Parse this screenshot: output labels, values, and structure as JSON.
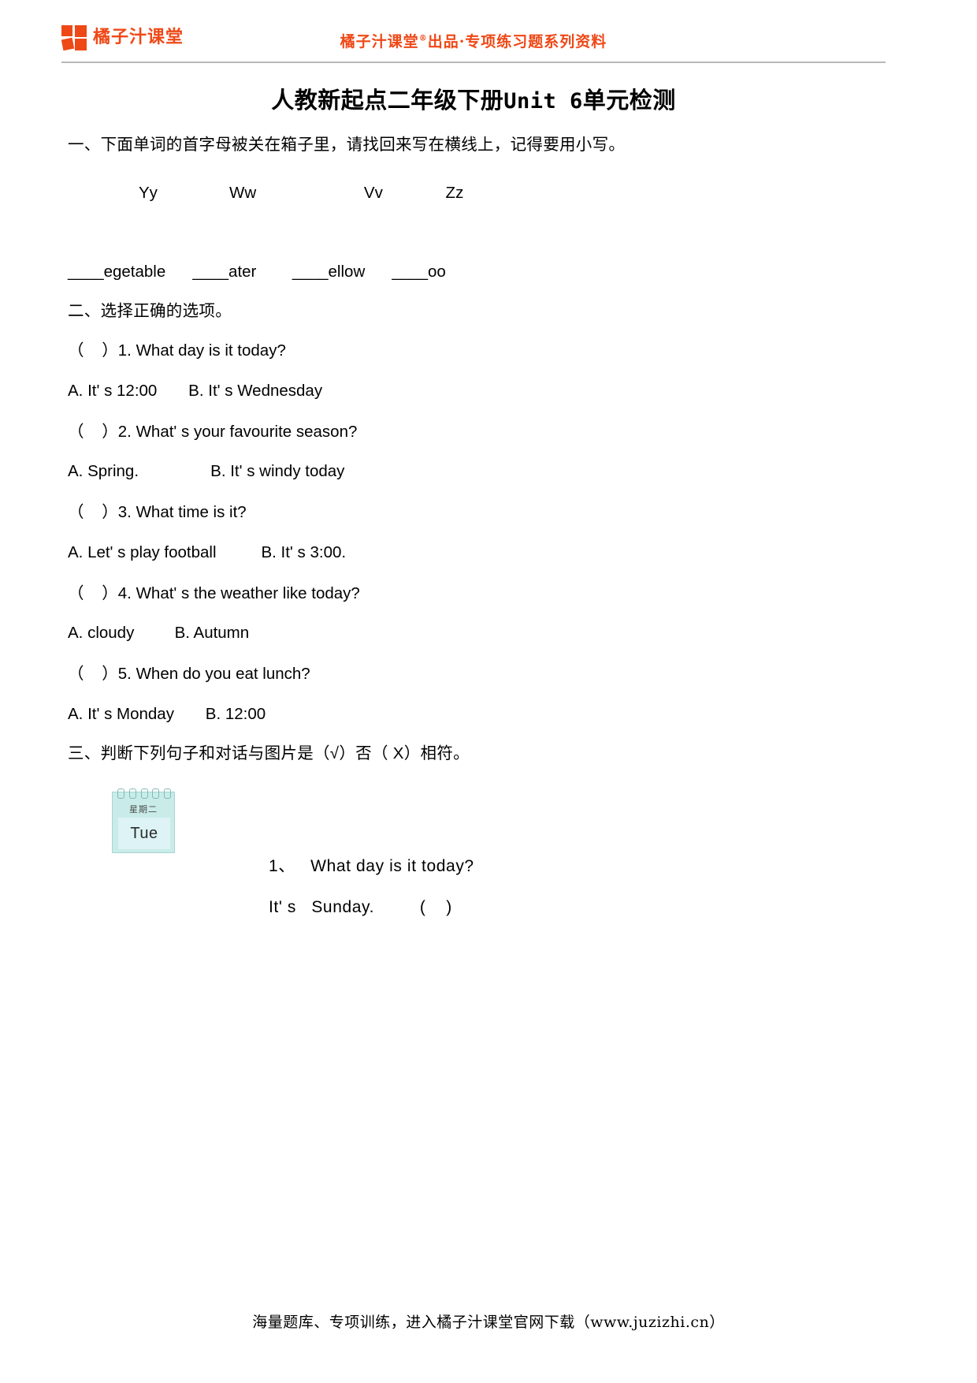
{
  "header": {
    "logo_text": "橘子汁课堂",
    "logo_icon": "four-squares-logo-icon",
    "brand_line_prefix": "橘子汁课堂",
    "brand_line_sup": "®",
    "brand_line_suffix": "出品·专项练习题系列资料",
    "accent_color": "#ef4817"
  },
  "doc": {
    "title_prefix": "人教新起点二年级下册",
    "title_mono": "Unit 6",
    "title_suffix": "单元检测"
  },
  "section_one": {
    "heading": "一、下面单词的首字母被关在箱子里，请找回来写在横线上，记得要用小写。",
    "letters_line": "Yy                Ww                        Vv              Zz",
    "blanks_line": "____egetable      ____ater        ____ellow      ____oo"
  },
  "section_two": {
    "heading": "二、选择正确的选项。",
    "items": [
      {
        "question": "（    ）1. What day is it today?",
        "options": "A. It' s 12:00       B. It' s Wednesday"
      },
      {
        "question": "（    ）2. What' s your favourite season?",
        "options": "A. Spring.                B. It' s windy today"
      },
      {
        "question": "（    ）3. What time is it?",
        "options": "A. Let' s play football          B. It' s 3:00."
      },
      {
        "question": "（    ）4. What' s the weather like today?",
        "options": "A. cloudy         B. Autumn"
      },
      {
        "question": "（    ）5. When do you eat lunch?",
        "options": "A. It' s Monday       B. 12:00"
      }
    ]
  },
  "section_three": {
    "heading": "三、判断下列句子和对话与图片是（√）否（ X）相符。",
    "calendar": {
      "weekday_cn": "星期二",
      "weekday_en": "Tue"
    },
    "item_line_1": "1、   What day is it today?",
    "item_line_2": "It' s   Sunday.         (    )"
  },
  "footer": {
    "text": "海量题库、专项训练，进入橘子汁课堂官网下载（www.juzizhi.cn）"
  }
}
